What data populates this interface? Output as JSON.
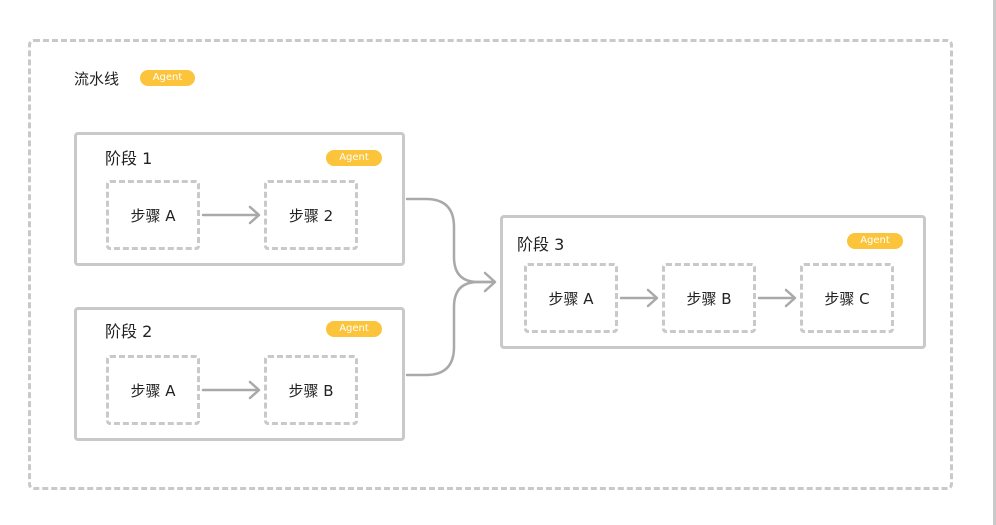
{
  "pipeline": {
    "title": "流水线",
    "badge": "Agent"
  },
  "stages": [
    {
      "title": "阶段 1",
      "badge": "Agent",
      "steps": [
        "步骤 A",
        "步骤 2"
      ]
    },
    {
      "title": "阶段 2",
      "badge": "Agent",
      "steps": [
        "步骤 A",
        "步骤 B"
      ]
    },
    {
      "title": "阶段 3",
      "badge": "Agent",
      "steps": [
        "步骤 A",
        "步骤 B",
        "步骤 C"
      ]
    }
  ],
  "colors": {
    "border": "#c9c9c9",
    "arrow": "#a9a9a9",
    "badge": "#fbc43b"
  }
}
